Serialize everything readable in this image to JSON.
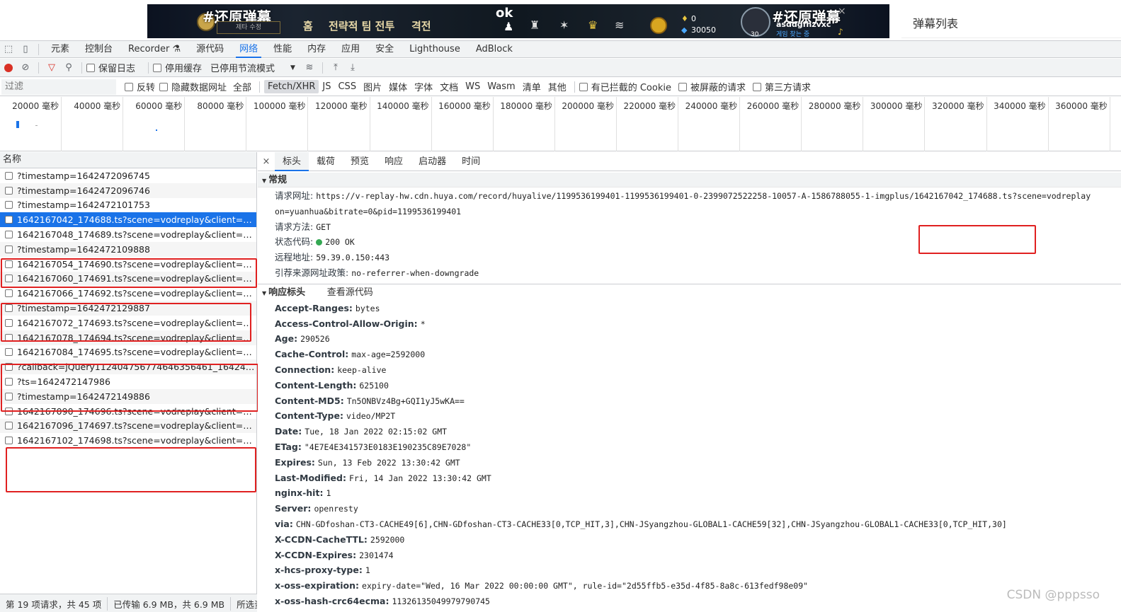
{
  "banner": {
    "hashtag_left": "#还原弹幕",
    "badge_text": "제타 수정",
    "menu": [
      "홈",
      "전략적 팀 전투",
      "격전"
    ],
    "ok_text": "ok",
    "coin_top": "0",
    "coin_bottom": "30050",
    "hashtag_right": "#还原弹幕",
    "username": "asddgfhzvxc",
    "user_sub": "게임 찾는 중",
    "level": "30"
  },
  "danmu_panel": {
    "title": "弹幕列表"
  },
  "devtools": {
    "main_tabs": [
      "元素",
      "控制台",
      "Recorder ⚗",
      "源代码",
      "网络",
      "性能",
      "内存",
      "应用",
      "安全",
      "Lighthouse",
      "AdBlock"
    ],
    "active_tab_index": 4,
    "toolbar": {
      "preserve_log": "保留日志",
      "disable_cache": "停用缓存",
      "throttle": "已停用节流模式"
    },
    "filter": {
      "placeholder": "过滤",
      "invert": "反转",
      "hide_data_urls": "隐藏数据网址",
      "types": [
        "全部",
        "Fetch/XHR",
        "JS",
        "CSS",
        "图片",
        "媒体",
        "字体",
        "文档",
        "WS",
        "Wasm",
        "清单",
        "其他"
      ],
      "active_type_index": 1,
      "blocked_cookies": "有已拦截的 Cookie",
      "blocked_requests": "被屏蔽的请求",
      "third_party": "第三方请求"
    },
    "overview_ticks": [
      "20000 毫秒",
      "40000 毫秒",
      "60000 毫秒",
      "80000 毫秒",
      "100000 毫秒",
      "120000 毫秒",
      "140000 毫秒",
      "160000 毫秒",
      "180000 毫秒",
      "200000 毫秒",
      "220000 毫秒",
      "240000 毫秒",
      "260000 毫秒",
      "280000 毫秒",
      "300000 毫秒",
      "320000 毫秒",
      "340000 毫秒",
      "360000 毫秒"
    ],
    "request_list": {
      "header": "名称",
      "rows": [
        "?timestamp=1642472096745",
        "?timestamp=1642472096746",
        "?timestamp=1642472101753",
        "1642167042_174688.ts?scene=vodreplay&client=81&vid...",
        "1642167048_174689.ts?scene=vodreplay&client=81&vid...",
        "?timestamp=1642472109888",
        "1642167054_174690.ts?scene=vodreplay&client=81&vid...",
        "1642167060_174691.ts?scene=vodreplay&client=81&vid...",
        "1642167066_174692.ts?scene=vodreplay&client=81&vid...",
        "?timestamp=1642472129887",
        "1642167072_174693.ts?scene=vodreplay&client=81&vid...",
        "1642167078_174694.ts?scene=vodreplay&client=81&vid...",
        "1642167084_174695.ts?scene=vodreplay&client=81&vid...",
        "?callback=jQuery112404756774646356461_1642471820...",
        "?ts=1642472147986",
        "?timestamp=1642472149886",
        "1642167090_174696.ts?scene=vodreplay&client=81&vid...",
        "1642167096_174697.ts?scene=vodreplay&client=81&vid...",
        "1642167102_174698.ts?scene=vodreplay&client=81&vid..."
      ],
      "selected_index": 3
    },
    "status": [
      "第 19 项请求，共 45 项",
      "已传输 6.9 MB，共 6.9 MB",
      "所选资"
    ],
    "detail": {
      "close": "×",
      "tabs": [
        "标头",
        "载荷",
        "预览",
        "响应",
        "启动器",
        "时间"
      ],
      "active_tab_index": 0,
      "general_title": "常规",
      "general": [
        {
          "k": "请求网址:",
          "v": "https://v-replay-hw.cdn.huya.com/record/huyalive/1199536199401-1199536199401-0-2399072522258-10057-A-1586788055-1-imgplus/1642167042_174688.ts?scene=vodreplay"
        },
        {
          "k": "",
          "v": "on=yuanhua&bitrate=0&pid=1199536199401"
        },
        {
          "k": "请求方法:",
          "v": "GET"
        },
        {
          "k": "状态代码:",
          "v": "200 OK"
        },
        {
          "k": "远程地址:",
          "v": "59.39.0.150:443"
        },
        {
          "k": "引荐来源网址政策:",
          "v": "no-referrer-when-downgrade"
        }
      ],
      "response_title": "响应标头",
      "view_source": "查看源代码",
      "response_headers": [
        {
          "k": "Accept-Ranges:",
          "v": "bytes"
        },
        {
          "k": "Access-Control-Allow-Origin:",
          "v": "*"
        },
        {
          "k": "Age:",
          "v": "290526"
        },
        {
          "k": "Cache-Control:",
          "v": "max-age=2592000"
        },
        {
          "k": "Connection:",
          "v": "keep-alive"
        },
        {
          "k": "Content-Length:",
          "v": "625100"
        },
        {
          "k": "Content-MD5:",
          "v": "Tn5ONBVz4Bg+GQI1yJ5wKA=="
        },
        {
          "k": "Content-Type:",
          "v": "video/MP2T"
        },
        {
          "k": "Date:",
          "v": "Tue, 18 Jan 2022 02:15:02 GMT"
        },
        {
          "k": "ETag:",
          "v": "\"4E7E4E341573E0183E190235C89E7028\""
        },
        {
          "k": "Expires:",
          "v": "Sun, 13 Feb 2022 13:30:42 GMT"
        },
        {
          "k": "Last-Modified:",
          "v": "Fri, 14 Jan 2022 13:30:42 GMT"
        },
        {
          "k": "nginx-hit:",
          "v": "1"
        },
        {
          "k": "Server:",
          "v": "openresty"
        },
        {
          "k": "via:",
          "v": "CHN-GDfoshan-CT3-CACHE49[6],CHN-GDfoshan-CT3-CACHE33[0,TCP_HIT,3],CHN-JSyangzhou-GLOBAL1-CACHE59[32],CHN-JSyangzhou-GLOBAL1-CACHE33[0,TCP_HIT,30]"
        },
        {
          "k": "X-CCDN-CacheTTL:",
          "v": "2592000"
        },
        {
          "k": "X-CCDN-Expires:",
          "v": "2301474"
        },
        {
          "k": "x-hcs-proxy-type:",
          "v": "1"
        },
        {
          "k": "x-oss-expiration:",
          "v": "expiry-date=\"Wed, 16 Mar 2022 00:00:00 GMT\", rule-id=\"2d55ffb5-e35d-4f85-8a8c-613fedf98e09\""
        },
        {
          "k": "x-oss-hash-crc64ecma:",
          "v": "11326135049979790745"
        }
      ]
    }
  },
  "watermark": "CSDN @pppsso",
  "colors": {
    "accent": "#1a73e8",
    "highlight": "#e02020",
    "status_ok": "#34a853"
  }
}
